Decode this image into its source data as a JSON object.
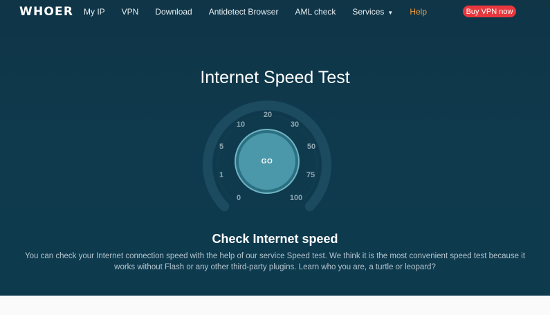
{
  "header": {
    "logo": "WHOER",
    "nav": [
      {
        "label": "My IP"
      },
      {
        "label": "VPN"
      },
      {
        "label": "Download"
      },
      {
        "label": "Antidetect Browser"
      },
      {
        "label": "AML check"
      },
      {
        "label": "Services"
      },
      {
        "label": "Help"
      }
    ],
    "buy_label": "Buy VPN now"
  },
  "main": {
    "title": "Internet Speed Test",
    "gauge": {
      "ticks": [
        "0",
        "1",
        "5",
        "10",
        "20",
        "30",
        "50",
        "75",
        "100"
      ],
      "go_label": "GO"
    },
    "subtitle": "Check Internet speed",
    "description": "You can check your Internet connection speed with the help of our service Speed test. We think it is the most convenient speed test because it works without Flash or any other third-party plugins. Learn who you are, a turtle or leopard?"
  },
  "colors": {
    "background": "#0f3a4e",
    "accent_button": "#e8383d",
    "help_link": "#f39a3a",
    "go_button": "#4a98aa"
  },
  "icons": {
    "services_dropdown": "chevron-down-icon"
  }
}
